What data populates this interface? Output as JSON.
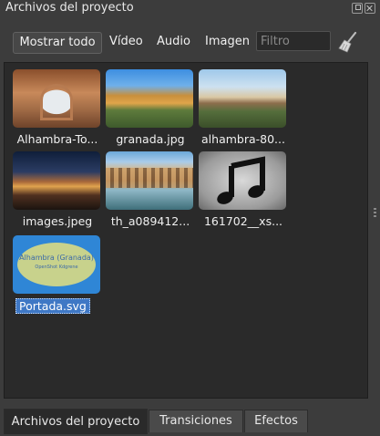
{
  "window": {
    "title": "Archivos del proyecto"
  },
  "filters": {
    "show_all": "Mostrar todo",
    "video": "Vídeo",
    "audio": "Audio",
    "image": "Imagen",
    "search_placeholder": "Filtro",
    "search_value": ""
  },
  "files": [
    {
      "name": "Alhambra-To...",
      "type": "image"
    },
    {
      "name": "granada.jpg",
      "type": "image"
    },
    {
      "name": "alhambra-80...",
      "type": "image"
    },
    {
      "name": "images.jpeg",
      "type": "image"
    },
    {
      "name": "th_a089412...",
      "type": "image"
    },
    {
      "name": "161702__xs...",
      "type": "audio"
    },
    {
      "name": "Portada.svg",
      "type": "image",
      "selected": true,
      "thumb_title": "Alhambra (Granada)",
      "thumb_subtitle": "OpenShot Kdgrene"
    }
  ],
  "tabs": [
    {
      "label": "Archivos del proyecto",
      "active": true
    },
    {
      "label": "Transiciones",
      "active": false
    },
    {
      "label": "Efectos",
      "active": false
    }
  ],
  "colors": {
    "selection": "#3f78c5",
    "panel_bg": "#2a2a2a",
    "window_bg": "#3c3c3c"
  }
}
